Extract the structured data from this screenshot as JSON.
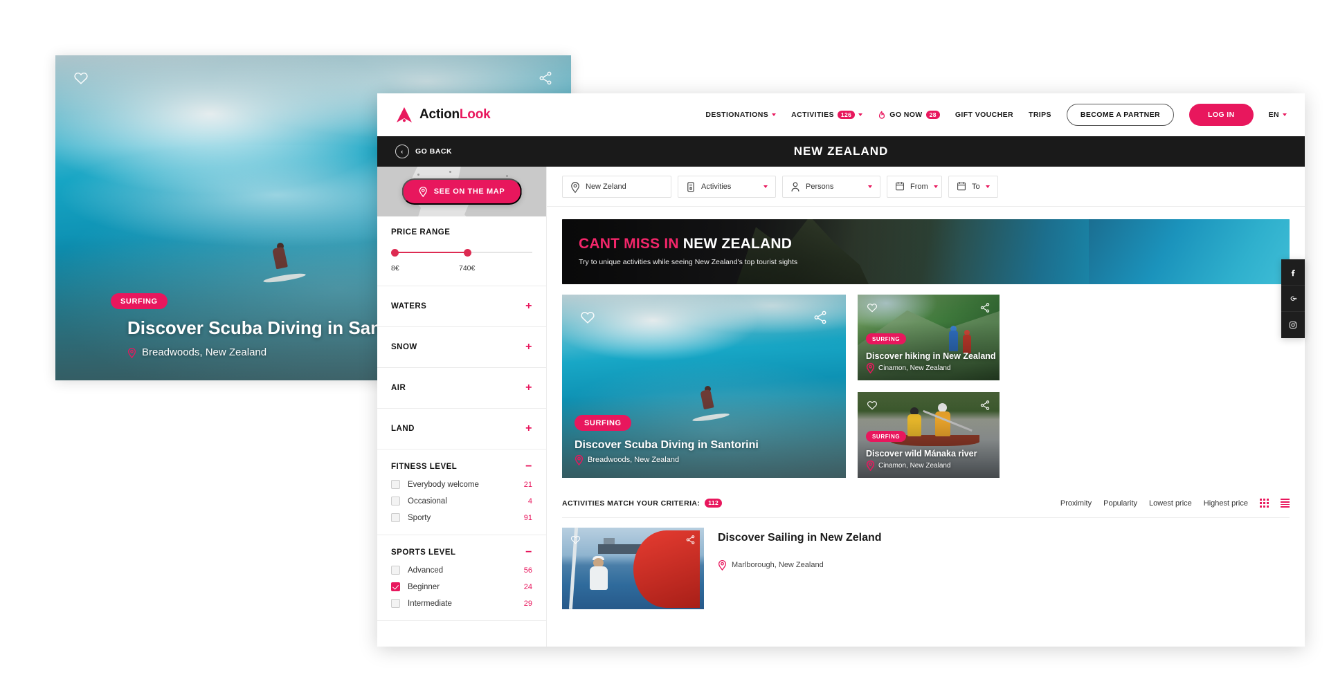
{
  "brand": {
    "name_first": "Action",
    "name_second": "Look",
    "accent_color": "#e8175d",
    "logo_icon": "mountain-triangle-icon"
  },
  "nav": {
    "items": [
      {
        "label": "DESTIONATIONS",
        "has_chevron": true,
        "badge": null,
        "icon": null
      },
      {
        "label": "ACTIVITIES",
        "has_chevron": true,
        "badge": "126",
        "icon": null
      },
      {
        "label": "GO NOW",
        "has_chevron": false,
        "badge": "28",
        "icon": "flame-icon"
      },
      {
        "label": "GIFT VOUCHER",
        "has_chevron": false,
        "badge": null,
        "icon": null
      },
      {
        "label": "TRIPS",
        "has_chevron": false,
        "badge": null,
        "icon": null
      }
    ],
    "partner_button": "BECOME A PARTNER",
    "login_button": "LOG IN",
    "language": "EN"
  },
  "titlebar": {
    "back_label": "GO BACK",
    "page_title": "NEW ZEALAND"
  },
  "search": {
    "location_value": "New Zeland",
    "activities_value": "Activities",
    "persons_value": "Persons",
    "date_from": "From",
    "date_to": "To"
  },
  "sidebar": {
    "map_button": "SEE ON THE MAP",
    "price": {
      "title": "PRICE RANGE",
      "min": "8€",
      "max": "740€"
    },
    "collapsed_sections": [
      {
        "title": "WATERS",
        "toggle": "+"
      },
      {
        "title": "SNOW",
        "toggle": "+"
      },
      {
        "title": "AIR",
        "toggle": "+"
      },
      {
        "title": "LAND",
        "toggle": "+"
      }
    ],
    "expanded_sections": [
      {
        "title": "FITNESS LEVEL",
        "toggle": "−",
        "options": [
          {
            "label": "Everybody welcome",
            "count": "21",
            "checked": false
          },
          {
            "label": "Occasional",
            "count": "4",
            "checked": false
          },
          {
            "label": "Sporty",
            "count": "91",
            "checked": false
          }
        ]
      },
      {
        "title": "SPORTS LEVEL",
        "toggle": "−",
        "options": [
          {
            "label": "Advanced",
            "count": "56",
            "checked": false
          },
          {
            "label": "Beginner",
            "count": "24",
            "checked": true
          },
          {
            "label": "Intermediate",
            "count": "29",
            "checked": false
          }
        ]
      }
    ]
  },
  "promo": {
    "title_accent": "CANT MISS IN",
    "title_rest": " NEW ZEALAND",
    "subtitle": "Try to unique activities while seeing New Zealand's top tourist sights"
  },
  "cards": {
    "main": {
      "badge": "SURFING",
      "title": "Discover Scuba Diving in Santorini",
      "location": "Breadwoods, New Zealand"
    },
    "side": [
      {
        "badge": "SURFING",
        "title": "Discover hiking in New Zealand",
        "location": "Cinamon, New Zealand"
      },
      {
        "badge": "SURFING",
        "title": "Discover wild Mánaka river",
        "location": "Cinamon, New Zealand"
      }
    ]
  },
  "results": {
    "criteria_label": "ACTIVITIES MATCH YOUR CRITERIA:",
    "criteria_count": "112",
    "sorts": [
      "Proximity",
      "Popularity",
      "Lowest price",
      "Highest price"
    ],
    "items": [
      {
        "title": "Discover Sailing in New Zeland",
        "location": "Marlborough, New Zealand"
      }
    ]
  },
  "background_card": {
    "badge": "SURFING",
    "title": "Discover Scuba Diving in Santorini",
    "location": "Breadwoods, New Zealand"
  },
  "social": [
    {
      "name": "facebook-icon"
    },
    {
      "name": "google-plus-icon"
    },
    {
      "name": "instagram-icon"
    }
  ]
}
